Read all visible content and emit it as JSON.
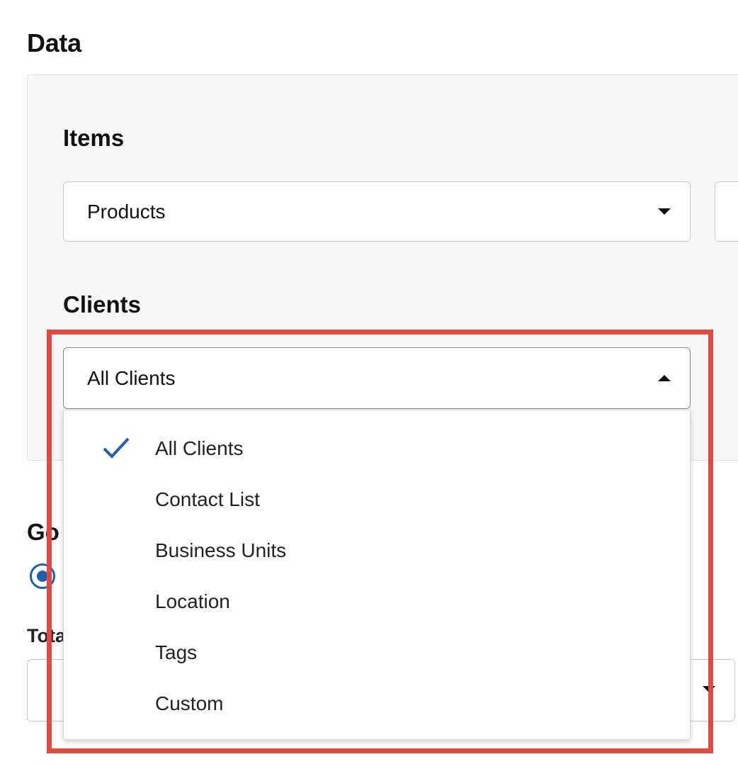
{
  "section": {
    "title": "Data"
  },
  "items": {
    "label": "Items",
    "selected": "Products"
  },
  "clients": {
    "label": "Clients",
    "selected": "All Clients",
    "options": [
      "All Clients",
      "Contact List",
      "Business Units",
      "Location",
      "Tags",
      "Custom"
    ]
  },
  "partial": {
    "goal_heading_fragment": "Go",
    "total_label_fragment": "Tota"
  },
  "colors": {
    "accent": "#1f5fad",
    "highlight": "#e14a43"
  },
  "icons": {
    "checked": "check-icon",
    "open": "chevron-up-icon",
    "closed": "chevron-down-icon"
  }
}
